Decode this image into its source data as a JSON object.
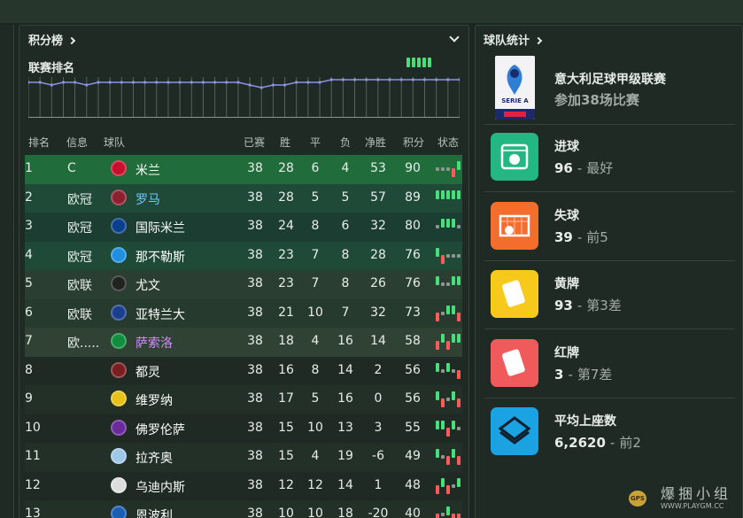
{
  "standings_panel": {
    "title": "积分榜"
  },
  "league_section": {
    "title": "联赛排名"
  },
  "position_history": [
    2,
    2,
    3,
    2,
    2,
    3,
    2,
    2,
    2,
    2,
    2,
    2,
    2,
    2,
    2,
    2,
    2,
    2,
    2,
    3,
    4,
    3,
    3,
    2,
    2,
    2,
    1,
    1,
    1,
    1,
    1,
    1,
    1,
    1,
    1,
    1,
    1,
    1
  ],
  "columns": {
    "pos": "排名",
    "info": "信息",
    "team": "球队",
    "played": "已赛",
    "won": "胜",
    "drawn": "平",
    "lost": "负",
    "gd": "净胜",
    "pts": "积分",
    "form": "状态"
  },
  "rows": [
    {
      "pos": "1",
      "info": "C",
      "team": "米兰",
      "played": "38",
      "won": "28",
      "drawn": "6",
      "lost": "4",
      "gd": "53",
      "pts": "90",
      "bg": "#216c3b",
      "team_color": "#ffffff",
      "badge": "#c8102e",
      "form": [
        "D",
        "D",
        "D",
        "L",
        "W"
      ]
    },
    {
      "pos": "2",
      "info": "欧冠",
      "team": "罗马",
      "played": "38",
      "won": "28",
      "drawn": "5",
      "lost": "5",
      "gd": "57",
      "pts": "89",
      "bg": "#1f4a38",
      "team_color": "#6bc8ff",
      "badge": "#8e1f2f",
      "form": [
        "W",
        "W",
        "W",
        "W",
        "W"
      ]
    },
    {
      "pos": "3",
      "info": "欧冠",
      "team": "国际米兰",
      "played": "38",
      "won": "24",
      "drawn": "8",
      "lost": "6",
      "gd": "32",
      "pts": "80",
      "bg": "#1c3d31",
      "team_color": "#ffffff",
      "badge": "#0a3f8c",
      "form": [
        "D",
        "W",
        "W",
        "W",
        "D"
      ]
    },
    {
      "pos": "4",
      "info": "欧冠",
      "team": "那不勒斯",
      "played": "38",
      "won": "23",
      "drawn": "7",
      "lost": "8",
      "gd": "28",
      "pts": "76",
      "bg": "#1f4a38",
      "team_color": "#ffffff",
      "badge": "#1f8fe0",
      "form": [
        "W",
        "L",
        "D",
        "D",
        "D"
      ]
    },
    {
      "pos": "5",
      "info": "欧联",
      "team": "尤文",
      "played": "38",
      "won": "23",
      "drawn": "7",
      "lost": "8",
      "gd": "26",
      "pts": "76",
      "bg": "#2a3f31",
      "team_color": "#ffffff",
      "badge": "#222222",
      "form": [
        "W",
        "D",
        "D",
        "W",
        "W"
      ]
    },
    {
      "pos": "6",
      "info": "欧联",
      "team": "亚特兰大",
      "played": "38",
      "won": "21",
      "drawn": "10",
      "lost": "7",
      "gd": "32",
      "pts": "73",
      "bg": "#263a2d",
      "team_color": "#ffffff",
      "badge": "#1b3f8f",
      "form": [
        "L",
        "D",
        "W",
        "W",
        "L"
      ]
    },
    {
      "pos": "7",
      "info": "欧.....",
      "team": "萨索洛",
      "played": "38",
      "won": "18",
      "drawn": "4",
      "lost": "16",
      "gd": "14",
      "pts": "58",
      "bg": "#2f4234",
      "team_color": "#d78cff",
      "badge": "#0f8f3e",
      "form": [
        "L",
        "W",
        "L",
        "W",
        "W"
      ]
    },
    {
      "pos": "8",
      "info": "",
      "team": "都灵",
      "played": "38",
      "won": "16",
      "drawn": "8",
      "lost": "14",
      "gd": "2",
      "pts": "56",
      "bg": "#1e2a23",
      "team_color": "#ffffff",
      "badge": "#7a1f1f",
      "form": [
        "W",
        "D",
        "W",
        "D",
        "L"
      ]
    },
    {
      "pos": "9",
      "info": "",
      "team": "维罗纳",
      "played": "38",
      "won": "17",
      "drawn": "5",
      "lost": "16",
      "gd": "0",
      "pts": "56",
      "bg": "#223028",
      "team_color": "#ffffff",
      "badge": "#e8c21a",
      "form": [
        "W",
        "L",
        "D",
        "W",
        "L"
      ]
    },
    {
      "pos": "10",
      "info": "",
      "team": "佛罗伦萨",
      "played": "38",
      "won": "15",
      "drawn": "10",
      "lost": "13",
      "gd": "3",
      "pts": "55",
      "bg": "#1e2a23",
      "team_color": "#ffffff",
      "badge": "#6a2a9a",
      "form": [
        "W",
        "W",
        "L",
        "W",
        "D"
      ]
    },
    {
      "pos": "11",
      "info": "",
      "team": "拉齐奥",
      "played": "38",
      "won": "15",
      "drawn": "4",
      "lost": "19",
      "gd": "-6",
      "pts": "49",
      "bg": "#223028",
      "team_color": "#ffffff",
      "badge": "#9fc7e8",
      "form": [
        "W",
        "D",
        "L",
        "W",
        "L"
      ]
    },
    {
      "pos": "12",
      "info": "",
      "team": "乌迪内斯",
      "played": "38",
      "won": "12",
      "drawn": "12",
      "lost": "14",
      "gd": "1",
      "pts": "48",
      "bg": "#1e2a23",
      "team_color": "#ffffff",
      "badge": "#dddddd",
      "form": [
        "L",
        "W",
        "L",
        "D",
        "W"
      ]
    },
    {
      "pos": "13",
      "info": "",
      "team": "恩波利",
      "played": "38",
      "won": "10",
      "drawn": "10",
      "lost": "18",
      "gd": "-20",
      "pts": "40",
      "bg": "#223028",
      "team_color": "#ffffff",
      "badge": "#1a5fb4",
      "form": [
        "L",
        "D",
        "W",
        "L",
        "L"
      ]
    }
  ],
  "stats_panel": {
    "title": "球队统计",
    "league_name": "意大利足球甲级联赛",
    "matches_text": "参加38场比赛",
    "logo_text": "SERIE A",
    "items": [
      {
        "label": "进球",
        "value": "96",
        "rank": "最好",
        "icon": "ball-in-net-icon",
        "color": "#23b883"
      },
      {
        "label": "失球",
        "value": "39",
        "rank": "前5",
        "icon": "conceded-goal-icon",
        "color": "#f36d2d"
      },
      {
        "label": "黄牌",
        "value": "93",
        "rank": "第3差",
        "icon": "yellow-card-icon",
        "color": "#f6c91a"
      },
      {
        "label": "红牌",
        "value": "3",
        "rank": "第7差",
        "icon": "red-card-icon",
        "color": "#f05a5a"
      },
      {
        "label": "平均上座数",
        "value": "6,2620",
        "rank": "前2",
        "icon": "stadium-icon",
        "color": "#1ba2e3"
      }
    ]
  },
  "watermark": {
    "text": "爆捆小组",
    "url": "WWW.PLAYGM.CC",
    "tag": "GPS"
  },
  "colors": {
    "win": "#46e07a",
    "loss": "#ff5a5a",
    "draw": "#8d9691",
    "chart_line": "#8b93e6"
  }
}
